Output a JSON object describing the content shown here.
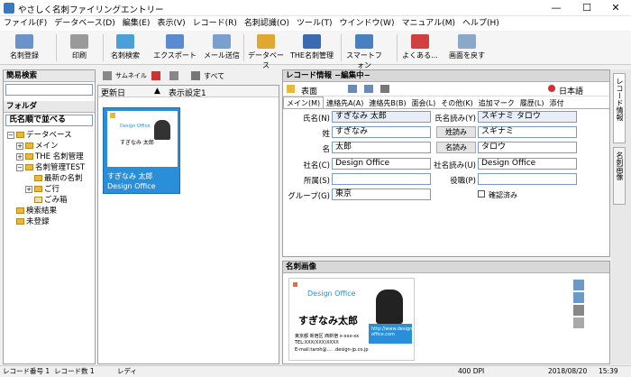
{
  "app": {
    "title": "やさしく名刺ファイリングエントリー"
  },
  "menu": [
    "ファイル(F)",
    "データベース(D)",
    "編集(E)",
    "表示(V)",
    "レコード(R)",
    "名刺認識(O)",
    "ツール(T)",
    "ウインドウ(W)",
    "マニュアル(M)",
    "ヘルプ(H)"
  ],
  "toolbar": {
    "register": "名刺登録",
    "print": "印刷",
    "search": "名刺検索",
    "export": "エクスポート",
    "mail": "メール送信",
    "database": "データベース",
    "the_manage": "THE名刺管理",
    "smartphone": "スマートフォン",
    "about": "よくある...",
    "back": "画面を戻す"
  },
  "left": {
    "quick_search": "簡易検索",
    "folder": "フォルダ",
    "sort": "氏名順で並べる",
    "tree": [
      "データベース",
      "メイン",
      "THE 名刺管理",
      "名刺管理TEST",
      "最新の名刺",
      "ご行",
      "ごみ箱",
      "検索結果",
      "未登録"
    ]
  },
  "middle": {
    "thumb_label": "サムネイル",
    "all_label": "すべて",
    "col_update": "更新日",
    "col_setting": "表示設定1",
    "card_name": "すぎなみ 太郎",
    "card_company": "Design Office",
    "card_mini_company": "Design Office",
    "card_mini_name": "すぎなみ 太郎"
  },
  "record": {
    "header": "レコード情報 −編集中−",
    "face": "表面",
    "lang": "日本語",
    "tabs": [
      "メイン(M)",
      "連絡先A(A)",
      "連絡先B(B)",
      "面会(L)",
      "その他(K)",
      "追加マーク",
      "履歴(L)",
      "添付"
    ],
    "labels": {
      "name": "氏名(N)",
      "last": "姓",
      "first": "名",
      "company": "社名(C)",
      "dept": "所属(S)",
      "group": "グループ(G)",
      "name_kana": "氏名読み(Y)",
      "last_kana": "姓読み",
      "first_kana": "名読み",
      "company_kana": "社名読み(U)",
      "title": "役職(P)",
      "confirmed": "確認済み"
    },
    "values": {
      "name": "すぎなみ 太郎",
      "last": "すぎなみ",
      "first": "太郎",
      "company": "Design Office",
      "dept": "",
      "group": "東京",
      "name_kana": "スギナミ タロウ",
      "last_kana": "スギナミ",
      "first_kana": "タロウ",
      "company_kana": "Design Office",
      "title": ""
    }
  },
  "image": {
    "header": "名刺画像",
    "brand": "Design Office",
    "person": "すぎなみ太郎",
    "url_line1": "http://www.design-",
    "url_line2": "office.com",
    "addr1": "東京都 新宿区 西新宿 x-xxx-xx",
    "tel": "TEL:XXX(XXX)XXXX",
    "mail": "E-mail:taroh@.... .design-jp.co.jp"
  },
  "side": {
    "record_info": "レコード情報",
    "card_image": "名刺画像"
  },
  "status": {
    "record_no": "レコード番号 1",
    "record_count": "レコード数 1",
    "ready": "レディ",
    "dpi": "400 DPI",
    "date": "2018/08/20",
    "time": "15:39"
  },
  "colors": {
    "accent": "#3b78c4",
    "card_blue": "#2a8fd8",
    "header_bg": "#d8d8d8"
  }
}
